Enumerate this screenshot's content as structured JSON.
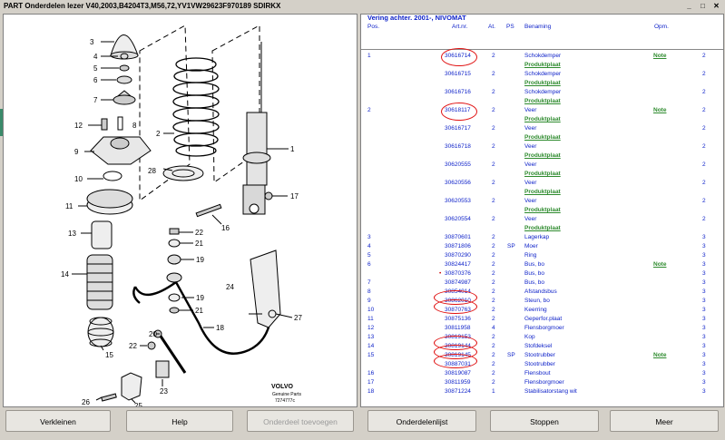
{
  "window": {
    "title": "PART Onderdelen lezer V40,2003,B4204T3,M56,72,YV1VW29623F970189 SDIRKX",
    "min": "_",
    "max": "□",
    "close": "✕"
  },
  "diagram": {
    "callouts": [
      "3",
      "4",
      "5",
      "6",
      "7",
      "12",
      "8",
      "9",
      "10",
      "11",
      "13",
      "14",
      "15",
      "2",
      "28",
      "1",
      "17",
      "16",
      "22",
      "21",
      "19",
      "19",
      "21",
      "24",
      "27",
      "18",
      "20",
      "22",
      "23",
      "25",
      "26"
    ],
    "brand": "VOLVO",
    "caption1": "Genuine Parts",
    "caption2": "7274777c"
  },
  "parts": {
    "header_title": "Vering achter. 2001-, NIVOMAT",
    "columns": {
      "pos": "Pos.",
      "art": "Art.nr.",
      "at": "At.",
      "ps": "PS",
      "ben": "Benaming",
      "opm": "Opm."
    },
    "rows": [
      {
        "pos": "1",
        "art": "30616714",
        "at": "2",
        "ps": "",
        "ben": "Schokdemper",
        "opm": "Note",
        "q": "2"
      },
      {
        "pos": "",
        "art": "",
        "at": "",
        "ps": "",
        "ben": "Produktplaat",
        "opm": "",
        "q": "",
        "pp": true
      },
      {
        "pos": "",
        "art": "30616715",
        "at": "2",
        "ps": "",
        "ben": "Schokdemper",
        "opm": "",
        "q": "2"
      },
      {
        "pos": "",
        "art": "",
        "at": "",
        "ps": "",
        "ben": "Produktplaat",
        "opm": "",
        "q": "",
        "pp": true
      },
      {
        "pos": "",
        "art": "30616716",
        "at": "2",
        "ps": "",
        "ben": "Schokdemper",
        "opm": "",
        "q": "2"
      },
      {
        "pos": "",
        "art": "",
        "at": "",
        "ps": "",
        "ben": "Produktplaat",
        "opm": "",
        "q": "",
        "pp": true
      },
      {
        "pos": "2",
        "art": "30618117",
        "at": "2",
        "ps": "",
        "ben": "Veer",
        "opm": "Note",
        "q": "2"
      },
      {
        "pos": "",
        "art": "",
        "at": "",
        "ps": "",
        "ben": "Produktplaat",
        "opm": "",
        "q": "",
        "pp": true
      },
      {
        "pos": "",
        "art": "30616717",
        "at": "2",
        "ps": "",
        "ben": "Veer",
        "opm": "",
        "q": "2"
      },
      {
        "pos": "",
        "art": "",
        "at": "",
        "ps": "",
        "ben": "Produktplaat",
        "opm": "",
        "q": "",
        "pp": true
      },
      {
        "pos": "",
        "art": "30616718",
        "at": "2",
        "ps": "",
        "ben": "Veer",
        "opm": "",
        "q": "2"
      },
      {
        "pos": "",
        "art": "",
        "at": "",
        "ps": "",
        "ben": "Produktplaat",
        "opm": "",
        "q": "",
        "pp": true
      },
      {
        "pos": "",
        "art": "30620555",
        "at": "2",
        "ps": "",
        "ben": "Veer",
        "opm": "",
        "q": "2"
      },
      {
        "pos": "",
        "art": "",
        "at": "",
        "ps": "",
        "ben": "Produktplaat",
        "opm": "",
        "q": "",
        "pp": true
      },
      {
        "pos": "",
        "art": "30620556",
        "at": "2",
        "ps": "",
        "ben": "Veer",
        "opm": "",
        "q": "2"
      },
      {
        "pos": "",
        "art": "",
        "at": "",
        "ps": "",
        "ben": "Produktplaat",
        "opm": "",
        "q": "",
        "pp": true
      },
      {
        "pos": "",
        "art": "30620553",
        "at": "2",
        "ps": "",
        "ben": "Veer",
        "opm": "",
        "q": "2"
      },
      {
        "pos": "",
        "art": "",
        "at": "",
        "ps": "",
        "ben": "Produktplaat",
        "opm": "",
        "q": "",
        "pp": true
      },
      {
        "pos": "",
        "art": "30620554",
        "at": "2",
        "ps": "",
        "ben": "Veer",
        "opm": "",
        "q": "2"
      },
      {
        "pos": "",
        "art": "",
        "at": "",
        "ps": "",
        "ben": "Produktplaat",
        "opm": "",
        "q": "",
        "pp": true
      },
      {
        "pos": "3",
        "art": "30870601",
        "at": "2",
        "ps": "",
        "ben": "Lagerkap",
        "opm": "",
        "q": "3"
      },
      {
        "pos": "4",
        "art": "30871806",
        "at": "2",
        "ps": "SP",
        "ben": "Moer",
        "opm": "",
        "q": "3"
      },
      {
        "pos": "5",
        "art": "30870290",
        "at": "2",
        "ps": "",
        "ben": "Ring",
        "opm": "",
        "q": "3"
      },
      {
        "pos": "6",
        "art": "30824417",
        "at": "2",
        "ps": "",
        "ben": "Bus, bo",
        "opm": "Note",
        "q": "3"
      },
      {
        "pos": "",
        "art": "30870376",
        "at": "2",
        "ps": "",
        "ben": "Bus, bo",
        "opm": "",
        "q": "3",
        "dot": "•"
      },
      {
        "pos": "7",
        "art": "30874987",
        "at": "2",
        "ps": "",
        "ben": "Bus, bo",
        "opm": "",
        "q": "3"
      },
      {
        "pos": "8",
        "art": "30854014",
        "at": "2",
        "ps": "",
        "ben": "Afstandsbus",
        "opm": "",
        "q": "3"
      },
      {
        "pos": "9",
        "art": "30862010",
        "at": "2",
        "ps": "",
        "ben": "Steun, bo",
        "opm": "",
        "q": "3"
      },
      {
        "pos": "10",
        "art": "30870763",
        "at": "2",
        "ps": "",
        "ben": "Keerring",
        "opm": "",
        "q": "3"
      },
      {
        "pos": "11",
        "art": "30875136",
        "at": "2",
        "ps": "",
        "ben": "Geperfor.plaat",
        "opm": "",
        "q": "3"
      },
      {
        "pos": "12",
        "art": "30811958",
        "at": "4",
        "ps": "",
        "ben": "Flensborgmoer",
        "opm": "",
        "q": "3"
      },
      {
        "pos": "13",
        "art": "30819153",
        "at": "2",
        "ps": "",
        "ben": "Kop",
        "opm": "",
        "q": "3"
      },
      {
        "pos": "14",
        "art": "30819144",
        "at": "2",
        "ps": "",
        "ben": "Stofdeksel",
        "opm": "",
        "q": "3"
      },
      {
        "pos": "15",
        "art": "30819145",
        "at": "2",
        "ps": "SP",
        "ben": "Stootrubber",
        "opm": "Note",
        "q": "3"
      },
      {
        "pos": "",
        "art": "30887031",
        "at": "2",
        "ps": "",
        "ben": "Stootrubber",
        "opm": "",
        "q": "3"
      },
      {
        "pos": "16",
        "art": "30819087",
        "at": "2",
        "ps": "",
        "ben": "Flensbout",
        "opm": "",
        "q": "3"
      },
      {
        "pos": "17",
        "art": "30811959",
        "at": "2",
        "ps": "",
        "ben": "Flensborgmoer",
        "opm": "",
        "q": "3"
      },
      {
        "pos": "18",
        "art": "30871224",
        "at": "1",
        "ps": "",
        "ben": "Stabilisatorstang wit",
        "opm": "",
        "q": "3"
      }
    ]
  },
  "buttons": {
    "verkleinen": "Verkleinen",
    "help": "Help",
    "toevoegen": "Onderdeel toevoegen",
    "lijst": "Onderdelenlijst",
    "stoppen": "Stoppen",
    "meer": "Meer"
  }
}
